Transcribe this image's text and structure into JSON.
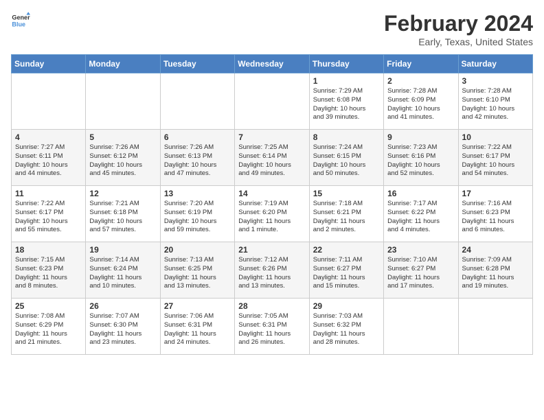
{
  "logo": {
    "text_general": "General",
    "text_blue": "Blue"
  },
  "title": "February 2024",
  "subtitle": "Early, Texas, United States",
  "days_of_week": [
    "Sunday",
    "Monday",
    "Tuesday",
    "Wednesday",
    "Thursday",
    "Friday",
    "Saturday"
  ],
  "weeks": [
    [
      {
        "num": "",
        "info": ""
      },
      {
        "num": "",
        "info": ""
      },
      {
        "num": "",
        "info": ""
      },
      {
        "num": "",
        "info": ""
      },
      {
        "num": "1",
        "info": "Sunrise: 7:29 AM\nSunset: 6:08 PM\nDaylight: 10 hours\nand 39 minutes."
      },
      {
        "num": "2",
        "info": "Sunrise: 7:28 AM\nSunset: 6:09 PM\nDaylight: 10 hours\nand 41 minutes."
      },
      {
        "num": "3",
        "info": "Sunrise: 7:28 AM\nSunset: 6:10 PM\nDaylight: 10 hours\nand 42 minutes."
      }
    ],
    [
      {
        "num": "4",
        "info": "Sunrise: 7:27 AM\nSunset: 6:11 PM\nDaylight: 10 hours\nand 44 minutes."
      },
      {
        "num": "5",
        "info": "Sunrise: 7:26 AM\nSunset: 6:12 PM\nDaylight: 10 hours\nand 45 minutes."
      },
      {
        "num": "6",
        "info": "Sunrise: 7:26 AM\nSunset: 6:13 PM\nDaylight: 10 hours\nand 47 minutes."
      },
      {
        "num": "7",
        "info": "Sunrise: 7:25 AM\nSunset: 6:14 PM\nDaylight: 10 hours\nand 49 minutes."
      },
      {
        "num": "8",
        "info": "Sunrise: 7:24 AM\nSunset: 6:15 PM\nDaylight: 10 hours\nand 50 minutes."
      },
      {
        "num": "9",
        "info": "Sunrise: 7:23 AM\nSunset: 6:16 PM\nDaylight: 10 hours\nand 52 minutes."
      },
      {
        "num": "10",
        "info": "Sunrise: 7:22 AM\nSunset: 6:17 PM\nDaylight: 10 hours\nand 54 minutes."
      }
    ],
    [
      {
        "num": "11",
        "info": "Sunrise: 7:22 AM\nSunset: 6:17 PM\nDaylight: 10 hours\nand 55 minutes."
      },
      {
        "num": "12",
        "info": "Sunrise: 7:21 AM\nSunset: 6:18 PM\nDaylight: 10 hours\nand 57 minutes."
      },
      {
        "num": "13",
        "info": "Sunrise: 7:20 AM\nSunset: 6:19 PM\nDaylight: 10 hours\nand 59 minutes."
      },
      {
        "num": "14",
        "info": "Sunrise: 7:19 AM\nSunset: 6:20 PM\nDaylight: 11 hours\nand 1 minute."
      },
      {
        "num": "15",
        "info": "Sunrise: 7:18 AM\nSunset: 6:21 PM\nDaylight: 11 hours\nand 2 minutes."
      },
      {
        "num": "16",
        "info": "Sunrise: 7:17 AM\nSunset: 6:22 PM\nDaylight: 11 hours\nand 4 minutes."
      },
      {
        "num": "17",
        "info": "Sunrise: 7:16 AM\nSunset: 6:23 PM\nDaylight: 11 hours\nand 6 minutes."
      }
    ],
    [
      {
        "num": "18",
        "info": "Sunrise: 7:15 AM\nSunset: 6:23 PM\nDaylight: 11 hours\nand 8 minutes."
      },
      {
        "num": "19",
        "info": "Sunrise: 7:14 AM\nSunset: 6:24 PM\nDaylight: 11 hours\nand 10 minutes."
      },
      {
        "num": "20",
        "info": "Sunrise: 7:13 AM\nSunset: 6:25 PM\nDaylight: 11 hours\nand 13 minutes."
      },
      {
        "num": "21",
        "info": "Sunrise: 7:12 AM\nSunset: 6:26 PM\nDaylight: 11 hours\nand 13 minutes."
      },
      {
        "num": "22",
        "info": "Sunrise: 7:11 AM\nSunset: 6:27 PM\nDaylight: 11 hours\nand 15 minutes."
      },
      {
        "num": "23",
        "info": "Sunrise: 7:10 AM\nSunset: 6:27 PM\nDaylight: 11 hours\nand 17 minutes."
      },
      {
        "num": "24",
        "info": "Sunrise: 7:09 AM\nSunset: 6:28 PM\nDaylight: 11 hours\nand 19 minutes."
      }
    ],
    [
      {
        "num": "25",
        "info": "Sunrise: 7:08 AM\nSunset: 6:29 PM\nDaylight: 11 hours\nand 21 minutes."
      },
      {
        "num": "26",
        "info": "Sunrise: 7:07 AM\nSunset: 6:30 PM\nDaylight: 11 hours\nand 23 minutes."
      },
      {
        "num": "27",
        "info": "Sunrise: 7:06 AM\nSunset: 6:31 PM\nDaylight: 11 hours\nand 24 minutes."
      },
      {
        "num": "28",
        "info": "Sunrise: 7:05 AM\nSunset: 6:31 PM\nDaylight: 11 hours\nand 26 minutes."
      },
      {
        "num": "29",
        "info": "Sunrise: 7:03 AM\nSunset: 6:32 PM\nDaylight: 11 hours\nand 28 minutes."
      },
      {
        "num": "",
        "info": ""
      },
      {
        "num": "",
        "info": ""
      }
    ]
  ]
}
